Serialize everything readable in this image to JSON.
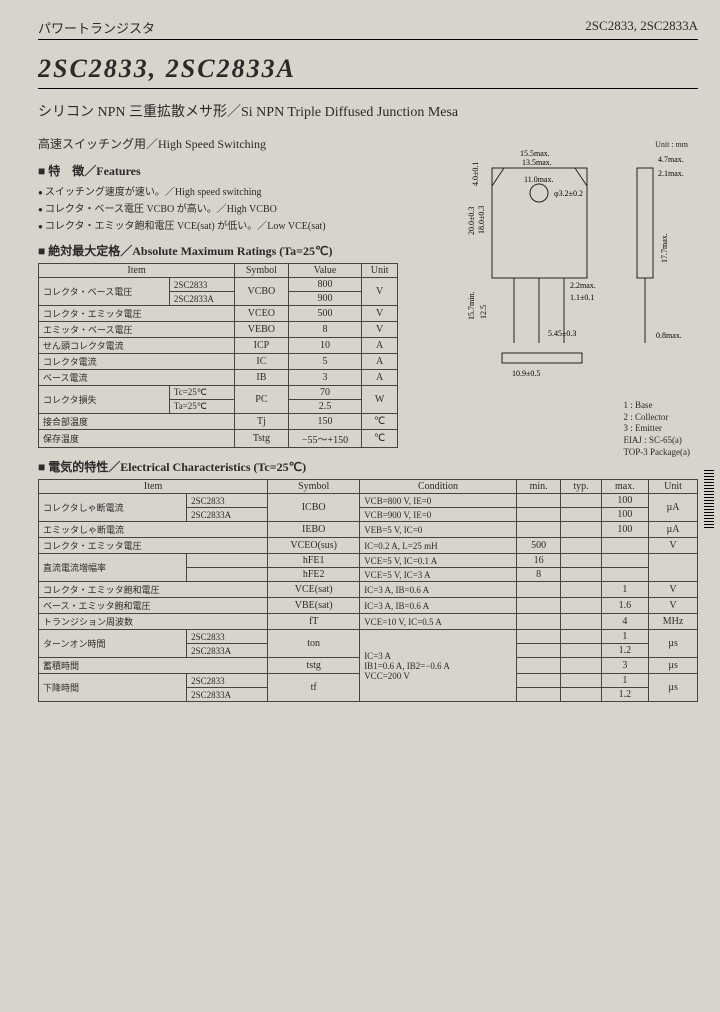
{
  "header": {
    "left": "パワートランジスタ",
    "right": "2SC2833, 2SC2833A"
  },
  "title": "2SC2833, 2SC2833A",
  "subtitle": "シリコン NPN 三重拡散メサ形／Si NPN Triple Diffused Junction Mesa",
  "usage": "高速スイッチング用／High Speed Switching",
  "features": {
    "head": "特　徴／Features",
    "items": [
      "スイッチング速度が速い。／High speed switching",
      "コレクタ・ベース電圧 VCBO が高い。／High VCBO",
      "コレクタ・エミッタ飽和電圧 VCE(sat) が低い。／Low VCE(sat)"
    ]
  },
  "ratings": {
    "head": "絶対最大定格／Absolute Maximum Ratings (Ta=25℃)",
    "cols": [
      "Item",
      "Symbol",
      "Value",
      "Unit"
    ],
    "rows": [
      {
        "item": "コレクタ・ベース電圧",
        "sub": "2SC2833",
        "symbol": "VCBO",
        "value": "800",
        "unit": "V"
      },
      {
        "item": "",
        "sub": "2SC2833A",
        "symbol": "",
        "value": "900",
        "unit": ""
      },
      {
        "item": "コレクタ・エミッタ電圧",
        "sub": "",
        "symbol": "VCEO",
        "value": "500",
        "unit": "V"
      },
      {
        "item": "エミッタ・ベース電圧",
        "sub": "",
        "symbol": "VEBO",
        "value": "8",
        "unit": "V"
      },
      {
        "item": "せん頭コレクタ電流",
        "sub": "",
        "symbol": "ICP",
        "value": "10",
        "unit": "A"
      },
      {
        "item": "コレクタ電流",
        "sub": "",
        "symbol": "IC",
        "value": "5",
        "unit": "A"
      },
      {
        "item": "ベース電流",
        "sub": "",
        "symbol": "IB",
        "value": "3",
        "unit": "A"
      },
      {
        "item": "コレクタ損失",
        "sub": "Tc=25℃",
        "symbol": "PC",
        "value": "70",
        "unit": "W"
      },
      {
        "item": "",
        "sub": "Ta=25℃",
        "symbol": "PC",
        "value": "2.5",
        "unit": ""
      },
      {
        "item": "接合部温度",
        "sub": "",
        "symbol": "Tj",
        "value": "150",
        "unit": "℃"
      },
      {
        "item": "保存温度",
        "sub": "",
        "symbol": "Tstg",
        "value": "−55～+150",
        "unit": "℃"
      }
    ]
  },
  "electrical": {
    "head": "電気的特性／Electrical Characteristics (Tc=25℃)",
    "cols": [
      "Item",
      "Symbol",
      "Condition",
      "min.",
      "typ.",
      "max.",
      "Unit"
    ],
    "rows": [
      {
        "item": "コレクタしゃ断電流",
        "sub": "2SC2833",
        "symbol": "ICBO",
        "cond": "VCB=800 V, IE=0",
        "min": "",
        "typ": "",
        "max": "100",
        "unit": "µA"
      },
      {
        "item": "",
        "sub": "2SC2833A",
        "symbol": "",
        "cond": "VCB=900 V, IE=0",
        "min": "",
        "typ": "",
        "max": "100",
        "unit": ""
      },
      {
        "item": "エミッタしゃ断電流",
        "sub": "",
        "symbol": "IEBO",
        "cond": "VEB=5 V, IC=0",
        "min": "",
        "typ": "",
        "max": "100",
        "unit": "µA"
      },
      {
        "item": "コレクタ・エミッタ電圧",
        "sub": "",
        "symbol": "VCEO(sus)",
        "cond": "IC=0.2 A, L=25 mH",
        "min": "500",
        "typ": "",
        "max": "",
        "unit": "V"
      },
      {
        "item": "直流電流増幅率",
        "sub": "",
        "symbol": "hFE1",
        "cond": "VCE=5 V, IC=0.1 A",
        "min": "16",
        "typ": "",
        "max": "",
        "unit": ""
      },
      {
        "item": "",
        "sub": "",
        "symbol": "hFE2",
        "cond": "VCE=5 V, IC=3 A",
        "min": "8",
        "typ": "",
        "max": "",
        "unit": ""
      },
      {
        "item": "コレクタ・エミッタ飽和電圧",
        "sub": "",
        "symbol": "VCE(sat)",
        "cond": "IC=3 A, IB=0.6 A",
        "min": "",
        "typ": "",
        "max": "1",
        "unit": "V"
      },
      {
        "item": "ベース・エミッタ飽和電圧",
        "sub": "",
        "symbol": "VBE(sat)",
        "cond": "IC=3 A, IB=0.6 A",
        "min": "",
        "typ": "",
        "max": "1.6",
        "unit": "V"
      },
      {
        "item": "トランジション周波数",
        "sub": "",
        "symbol": "fT",
        "cond": "VCE=10 V, IC=0.5 A",
        "min": "",
        "typ": "",
        "max": "4",
        "unit": "MHz"
      },
      {
        "item": "ターンオン時間",
        "sub": "2SC2833",
        "symbol": "ton",
        "cond": "",
        "min": "",
        "typ": "",
        "max": "1",
        "unit": "µs"
      },
      {
        "item": "",
        "sub": "2SC2833A",
        "symbol": "",
        "cond": "IC=3 A",
        "min": "",
        "typ": "",
        "max": "1.2",
        "unit": ""
      },
      {
        "item": "蓄積時間",
        "sub": "",
        "symbol": "tstg",
        "cond": "IB1=0.6 A, IB2=−0.6 A",
        "min": "",
        "typ": "",
        "max": "3",
        "unit": "µs"
      },
      {
        "item": "下降時間",
        "sub": "2SC2833",
        "symbol": "tf",
        "cond": "VCC=200 V",
        "min": "",
        "typ": "",
        "max": "1",
        "unit": "µs"
      },
      {
        "item": "",
        "sub": "2SC2833A",
        "symbol": "",
        "cond": "",
        "min": "",
        "typ": "",
        "max": "1.2",
        "unit": ""
      }
    ]
  },
  "package": {
    "unit_label": "Unit : mm",
    "dims": {
      "w_max": "15.5max.",
      "w_inner": "13.5max.",
      "w_slot": "11.0max.",
      "side_h": "4.7max.",
      "side_t": "2.1max.",
      "h1": "20.0±0.3",
      "h2": "18.0±0.3",
      "hole": "φ3.2±0.2",
      "lead_len": "15.7min.",
      "lead_gap": "12.5",
      "lead_inset": "2.2max.",
      "lead_w": "1.1±0.1",
      "pitch": "5.45±0.3",
      "base_w": "10.9±0.5",
      "thick": "0.8max.",
      "side_len": "17.7max."
    },
    "pins": {
      "1": "1 : Base",
      "2": "2 : Collector",
      "3": "3 : Emitter",
      "pkg1": "EIAJ : SC-65(a)",
      "pkg2": "TOP-3 Package(a)"
    }
  }
}
